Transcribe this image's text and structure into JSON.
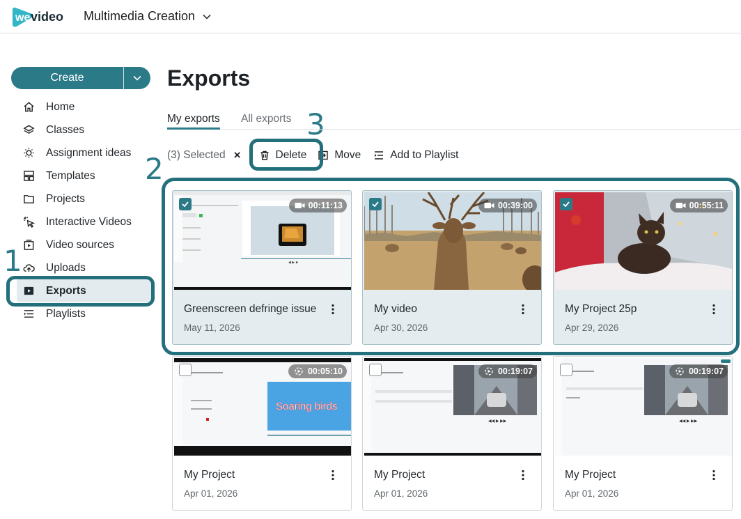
{
  "app": {
    "logo_text": "wevideo",
    "workspace": "Multimedia Creation"
  },
  "sidebar": {
    "create_label": "Create",
    "items": [
      {
        "label": "Home",
        "icon": "home-icon"
      },
      {
        "label": "Classes",
        "icon": "layers-icon"
      },
      {
        "label": "Assignment ideas",
        "icon": "lightbulb-icon"
      },
      {
        "label": "Templates",
        "icon": "templates-icon"
      },
      {
        "label": "Projects",
        "icon": "folder-icon"
      },
      {
        "label": "Interactive Videos",
        "icon": "sparkle-cursor-icon"
      },
      {
        "label": "Video sources",
        "icon": "video-source-icon"
      },
      {
        "label": "Uploads",
        "icon": "cloud-upload-icon"
      },
      {
        "label": "Exports",
        "icon": "play-box-icon",
        "active": true
      },
      {
        "label": "Playlists",
        "icon": "playlist-icon"
      }
    ]
  },
  "main": {
    "title": "Exports",
    "tabs": [
      {
        "label": "My exports",
        "active": true
      },
      {
        "label": "All exports",
        "active": false
      }
    ],
    "toolbar": {
      "selected": "(3) Selected",
      "clear": "×",
      "delete": "Delete",
      "move": "Move",
      "add_to_playlist": "Add to Playlist"
    },
    "cards": [
      {
        "title": "Greenscreen defringe issue",
        "date": "May 11, 2026",
        "duration": "00:11:13",
        "selected": true
      },
      {
        "title": "My video",
        "date": "Apr 30, 2026",
        "duration": "00:39:00",
        "selected": true
      },
      {
        "title": "My Project 25p",
        "date": "Apr 29, 2026",
        "duration": "00:55:11",
        "selected": true
      },
      {
        "title": "My Project",
        "date": "Apr 01, 2026",
        "duration": "00:05:10",
        "selected": false
      },
      {
        "title": "My Project",
        "date": "Apr 01, 2026",
        "duration": "00:19:07",
        "selected": false
      },
      {
        "title": "My Project",
        "date": "Apr 01, 2026",
        "duration": "00:19:07",
        "selected": false
      }
    ],
    "thumb_text": {
      "soaring_birds": "Soaring birds"
    }
  },
  "annotations": {
    "step1": "1",
    "step2": "2",
    "step3": "3"
  },
  "colors": {
    "accent": "#2b7a88",
    "highlight": "#23707c",
    "selected_card": "#e4ecef"
  }
}
